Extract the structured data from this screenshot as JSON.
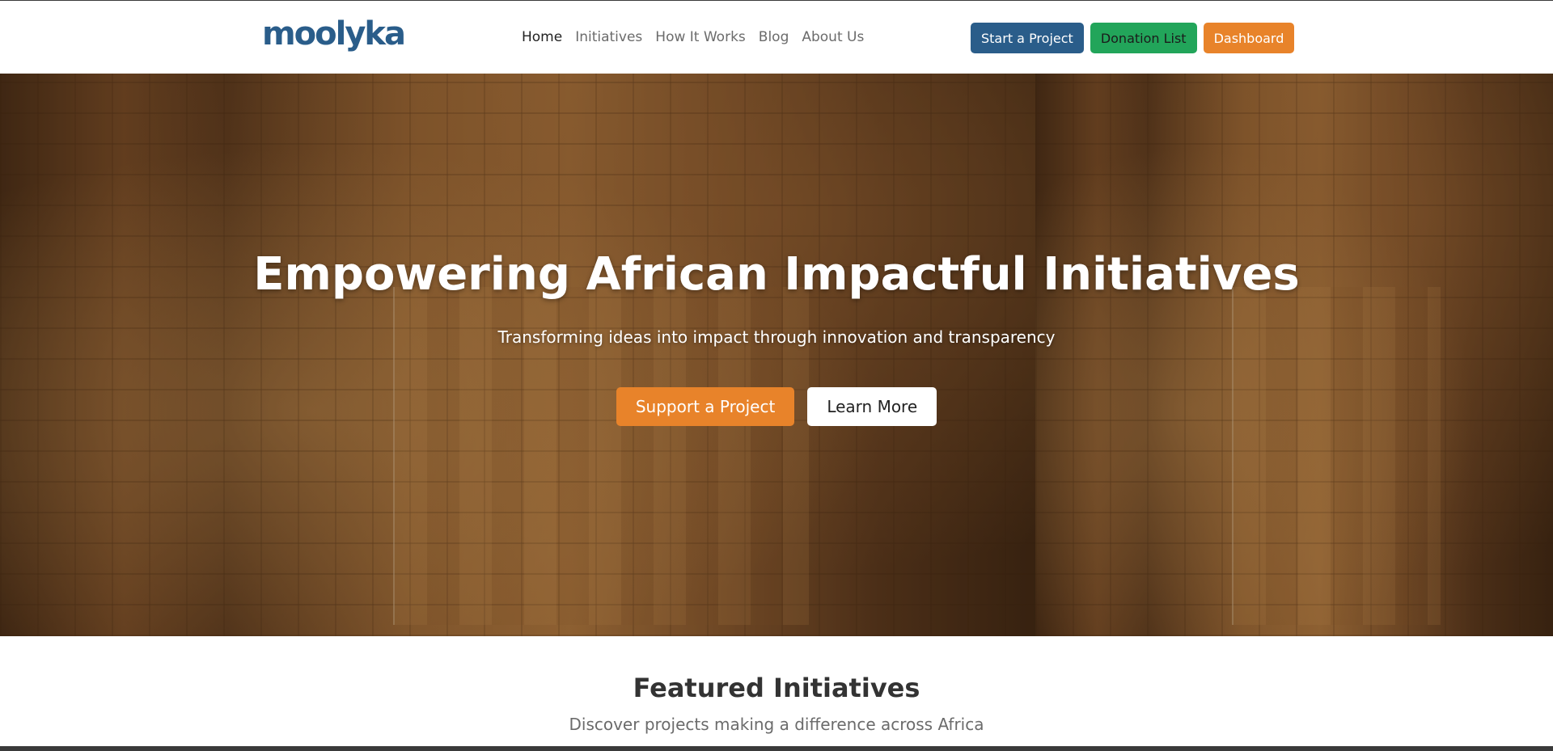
{
  "colors": {
    "brand_blue": "#2a5d8a",
    "success_green": "#22a55a",
    "accent_orange": "#e8832a",
    "white": "#ffffff"
  },
  "navbar": {
    "logo": "moolyka",
    "links": [
      {
        "label": "Home",
        "active": true
      },
      {
        "label": "Initiatives",
        "active": false
      },
      {
        "label": "How It Works",
        "active": false
      },
      {
        "label": "Blog",
        "active": false
      },
      {
        "label": "About Us",
        "active": false
      }
    ],
    "actions": {
      "start_project": "Start a Project",
      "donation_list": "Donation List",
      "dashboard": "Dashboard"
    }
  },
  "hero": {
    "title": "Empowering African Impactful Initiatives",
    "subtitle": "Transforming ideas into impact through innovation and transparency",
    "primary_button": "Support a Project",
    "secondary_button": "Learn More",
    "background_image": "aerial view of a township with a dirt football pitch"
  },
  "featured": {
    "title": "Featured Initiatives",
    "subtitle": "Discover projects making a difference across Africa"
  }
}
